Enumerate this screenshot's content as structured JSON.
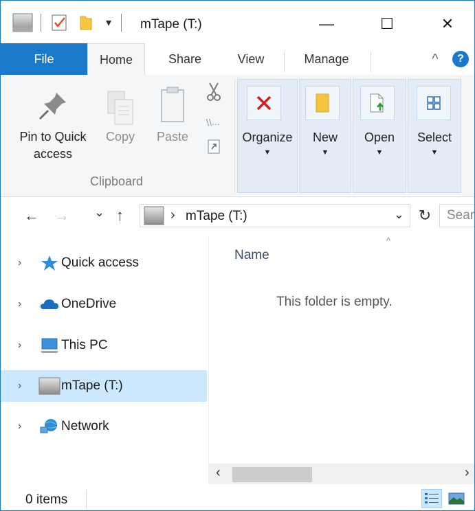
{
  "window": {
    "title": "mTape (T:)",
    "controls": {
      "minimize": "—",
      "maximize": "☐",
      "close": "✕"
    },
    "quick_access_dropdown": "▾"
  },
  "ribbon_tabs": [
    "File",
    "Home",
    "Share",
    "View",
    "Manage"
  ],
  "ribbon_right": {
    "collapse": "^",
    "help": "?"
  },
  "clipboard_group": {
    "pin_label_1": "Pin to Quick",
    "pin_label_2": "access",
    "copy_label": "Copy",
    "paste_label": "Paste",
    "group_label": "Clipboard"
  },
  "ribbon_buttons": [
    {
      "label": "Organize",
      "arrow": "▼"
    },
    {
      "label": "New",
      "arrow": "▼"
    },
    {
      "label": "Open",
      "arrow": "▼"
    },
    {
      "label": "Select",
      "arrow": "▼"
    }
  ],
  "address_bar": {
    "back": "←",
    "forward": "→",
    "recent": "⌄",
    "up": "↑",
    "path_separator": "›",
    "path": "mTape (T:)",
    "dropdown": "⌄",
    "refresh": "↻",
    "search_placeholder": "Search"
  },
  "nav_pane": {
    "items": [
      {
        "label": "Quick access",
        "icon": "star-icon",
        "selected": false
      },
      {
        "label": "OneDrive",
        "icon": "cloud-icon",
        "selected": false
      },
      {
        "label": "This PC",
        "icon": "computer-icon",
        "selected": false
      },
      {
        "label": "mTape (T:)",
        "icon": "drive-icon",
        "selected": true
      },
      {
        "label": "Network",
        "icon": "network-icon",
        "selected": false
      }
    ],
    "expand_chevron": "›"
  },
  "content": {
    "sort_caret": "^",
    "column_name": "Name",
    "empty_message": "This folder is empty."
  },
  "scrollbar": {
    "left": "‹",
    "right": "›"
  },
  "status": {
    "items_count": "0 items"
  },
  "colors": {
    "accent": "#1979ca",
    "selection": "#cce8ff",
    "ribbon_bg": "#f5f6f7"
  }
}
